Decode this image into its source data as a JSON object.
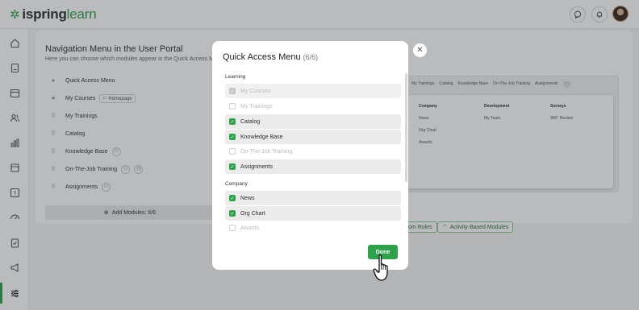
{
  "header": {
    "logo_ispring": "ispring",
    "logo_learn": "learn",
    "icons": [
      "chat-icon",
      "bell-icon",
      "avatar"
    ]
  },
  "sidebar": {
    "items": [
      "home-icon",
      "book-icon",
      "calendar-icon",
      "users-icon",
      "chart-icon",
      "layers-icon",
      "quiz-icon",
      "activity-icon",
      "clipboard-icon",
      "megaphone-icon",
      "settings-sliders-icon"
    ],
    "active": "settings-sliders-icon"
  },
  "page": {
    "title": "Navigation Menu in the User Portal",
    "subtitle": "Here you can choose which modules appear in the Quick Access Me",
    "rows": [
      {
        "label": "Quick Access Menu"
      },
      {
        "label": "My Courses",
        "pill": "Homepage"
      },
      {
        "label": "My Trainings"
      },
      {
        "label": "Catalog"
      },
      {
        "label": "Knowledge Base"
      },
      {
        "label": "On-The-Job Training"
      },
      {
        "label": "Assignments"
      }
    ],
    "add_modules": "Add Modules: 6/6",
    "preview_menu": [
      "My Trainings",
      "Catalog",
      "Knowledge Base",
      "On-The-Job Training",
      "Assignments"
    ],
    "preview_cols": [
      {
        "header": "Company",
        "items": [
          "News",
          "Org Chart",
          "Awards"
        ]
      },
      {
        "header": "Development",
        "items": [
          "My Team"
        ]
      },
      {
        "header": "Surveys",
        "items": [
          "360° Review"
        ]
      }
    ],
    "bottom_pills": [
      "om Roles",
      "Activity-Based Modules"
    ]
  },
  "modal": {
    "title": "Quick Access Menu",
    "count": "(6/6)",
    "sections": [
      {
        "label": "Learning",
        "options": [
          {
            "label": "My Courses",
            "checked": true,
            "disabled": true
          },
          {
            "label": "My Trainings",
            "checked": false,
            "disabled": true
          },
          {
            "label": "Catalog",
            "checked": true,
            "disabled": false
          },
          {
            "label": "Knowledge Base",
            "checked": true,
            "disabled": false
          },
          {
            "label": "On-The-Job Training",
            "checked": false,
            "disabled": true
          },
          {
            "label": "Assignments",
            "checked": true,
            "disabled": false
          }
        ]
      },
      {
        "label": "Company",
        "options": [
          {
            "label": "News",
            "checked": true,
            "disabled": false
          },
          {
            "label": "Org Chart",
            "checked": true,
            "disabled": false
          },
          {
            "label": "Awards",
            "checked": false,
            "disabled": true
          }
        ]
      }
    ],
    "done_label": "Done"
  },
  "colors": {
    "accent": "#2ea24a"
  }
}
